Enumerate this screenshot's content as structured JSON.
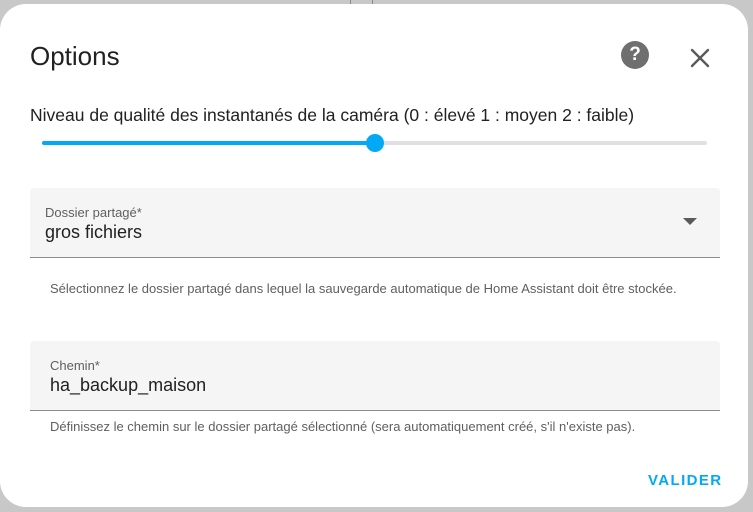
{
  "dialog": {
    "title": "Options",
    "help_icon_glyph": "?"
  },
  "slider": {
    "label": "Niveau de qualité des instantanés de la caméra (0 : élevé 1 : moyen 2 : faible)",
    "min": 0,
    "max": 2,
    "value": 1
  },
  "share_field": {
    "label": "Dossier partagé*",
    "value": "gros fichiers",
    "helper": "Sélectionnez le dossier partagé dans lequel la sauvegarde automatique de Home Assistant doit être stockée."
  },
  "path_field": {
    "label": "Chemin*",
    "value": "ha_backup_maison",
    "helper": "Définissez le chemin sur le dossier partagé sélectionné (sera automatiquement créé, s'il n'existe pas)."
  },
  "actions": {
    "submit_label": "VALIDER"
  },
  "colors": {
    "accent": "#03a9f4",
    "text": "#212121",
    "secondary_text": "#5f5f5f",
    "field_bg": "#f5f5f5"
  },
  "icons": [
    "help-icon",
    "close-icon",
    "dropdown-arrow-icon"
  ]
}
